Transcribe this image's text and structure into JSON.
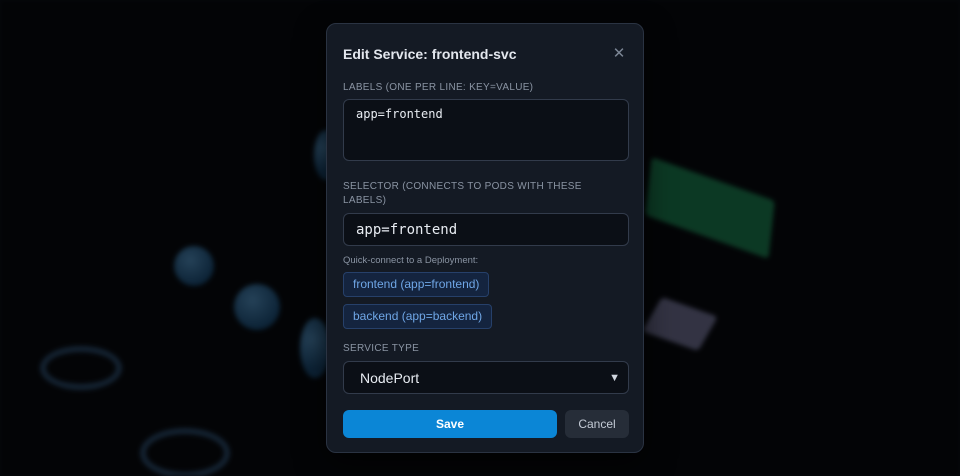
{
  "modal": {
    "title": "Edit Service: frontend-svc",
    "close_icon": "close-icon"
  },
  "labels_field": {
    "label": "LABELS (ONE PER LINE: KEY=VALUE)",
    "value": "app=frontend"
  },
  "selector_field": {
    "label": "SELECTOR (CONNECTS TO PODS WITH THESE LABELS)",
    "value": "app=frontend"
  },
  "quick_connect": {
    "hint": "Quick-connect to a Deployment:",
    "options": [
      {
        "label": "frontend (app=frontend)"
      },
      {
        "label": "backend (app=backend)"
      }
    ]
  },
  "service_type": {
    "label": "SERVICE TYPE",
    "selected": "NodePort"
  },
  "actions": {
    "save_label": "Save",
    "cancel_label": "Cancel"
  },
  "colors": {
    "accent": "#0b86d6",
    "chip_text": "#6fa6e6",
    "modal_bg": "#141a24",
    "page_bg": "#06080c"
  }
}
